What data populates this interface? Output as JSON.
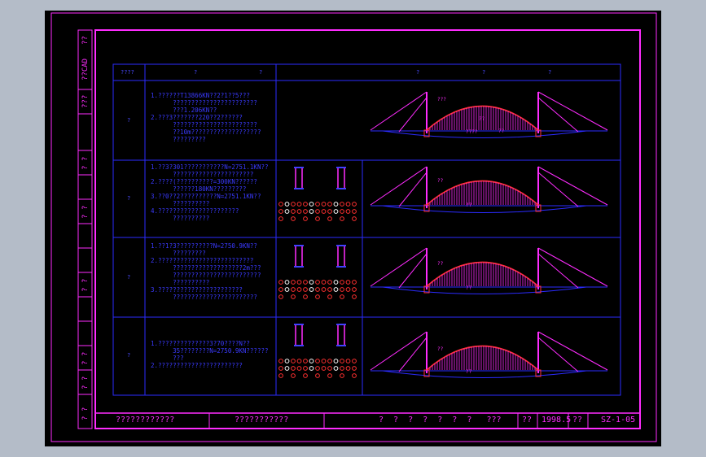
{
  "header": {
    "col_num": "????",
    "col_b": "?",
    "col_c": "?",
    "col_d": "?",
    "col_e": "?",
    "col_f": "?"
  },
  "side_labels": [
    "??",
    "??CAD",
    "???",
    "? ?",
    "? ?",
    "? ?",
    "? ?",
    "? ?",
    "? ?"
  ],
  "rows": [
    {
      "num": "?",
      "note": "1.??????T13866KN??2?1??5???\n      ???????????????????????\n      ???1.206KN??\n2.???3???????220??2??????\n      ???????????????????????\n      ??10m???????????????????\n      ?????????",
      "arch_labels": [
        "???",
        "??",
        "????",
        "??"
      ]
    },
    {
      "num": "?",
      "note": "1.??3?301???????????N=2751.1KN??\n      ??????????????????????\n2.????(??????????=300KN??????\n      ??????180KN?????????\n3.??0??2??????????N=2751.1KN??\n      ??????????\n4.??????????????????????\n      ??????????",
      "arch_labels": [
        "??",
        "??"
      ]
    },
    {
      "num": "?",
      "note": "1.??1?3??????????N=2750.9KN??\n      ?????????\n2.??????????????????????????\n      ???????????????????2m???\n      ????????????????????????\n      ??????????\n3.???????????????????????\n      ???????????????????????",
      "arch_labels": [
        "??",
        "??"
      ]
    },
    {
      "num": "?",
      "note": "1.??????????????3?70????N??\n      35????????N=2750.9KN??????\n      ???\n2.???????????????????????",
      "arch_labels": [
        "??",
        "??"
      ]
    }
  ],
  "title_block": {
    "cell1": "????????????",
    "cell2": "???????????",
    "cell3": "?  ?  ?  ?  ?  ?  ?   ???",
    "cell4": "??",
    "date": "1998.5",
    "cell6": "??",
    "drawing_no": "SZ-1-05"
  },
  "colors": {
    "background": "#000000",
    "frame": "#ff2cff",
    "grid": "#2b2bff",
    "arch": "#ff2cff",
    "arch_top": "#ff3030",
    "desktop": "#b4bcc8"
  }
}
